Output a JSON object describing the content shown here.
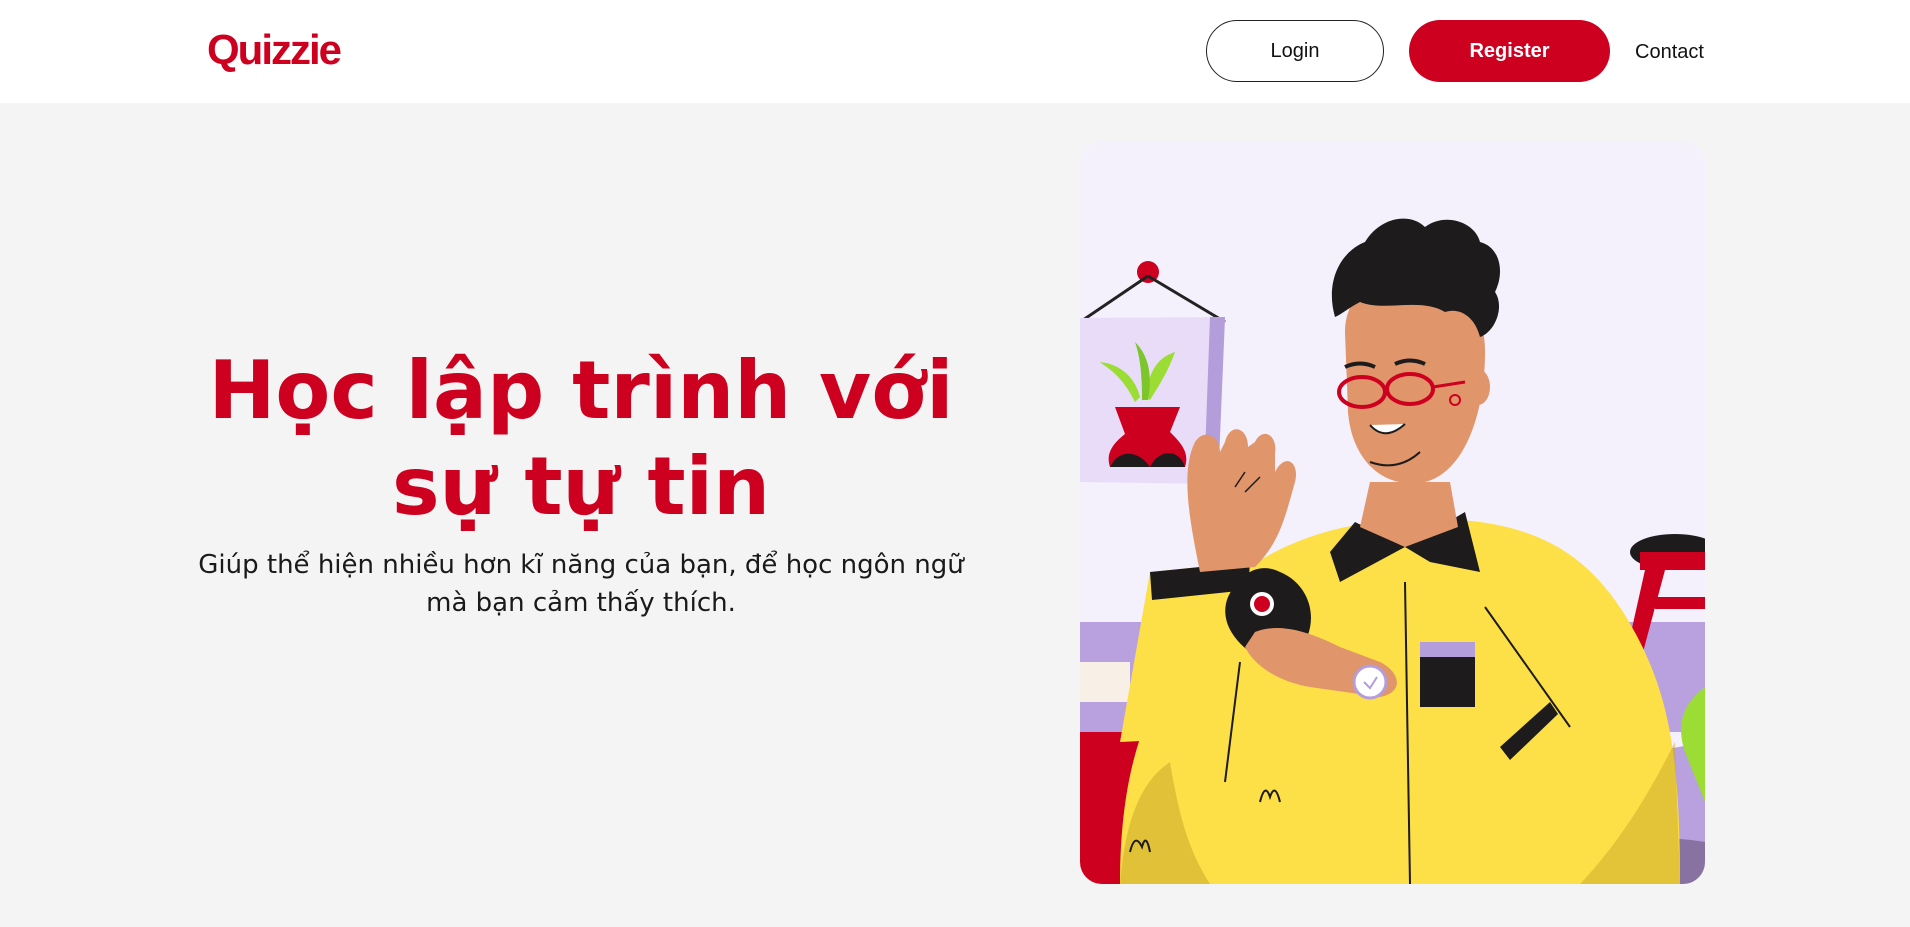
{
  "header": {
    "logo_text": "Quizzie",
    "login_label": "Login",
    "register_label": "Register",
    "contact_label": "Contact"
  },
  "hero": {
    "title_line1": "Học lập trình với",
    "title_line2": "sự tự tin",
    "subtitle_line1": "Giúp thể hiện nhiều hơn kĩ năng của bạn, để học ngôn ngữ",
    "subtitle_line2": "mà bạn cảm thấy thích."
  },
  "colors": {
    "brand_red": "#cd0020",
    "background": "#f4f4f4",
    "illustration_yellow": "#fde047",
    "illustration_purple": "#b39ddb"
  }
}
